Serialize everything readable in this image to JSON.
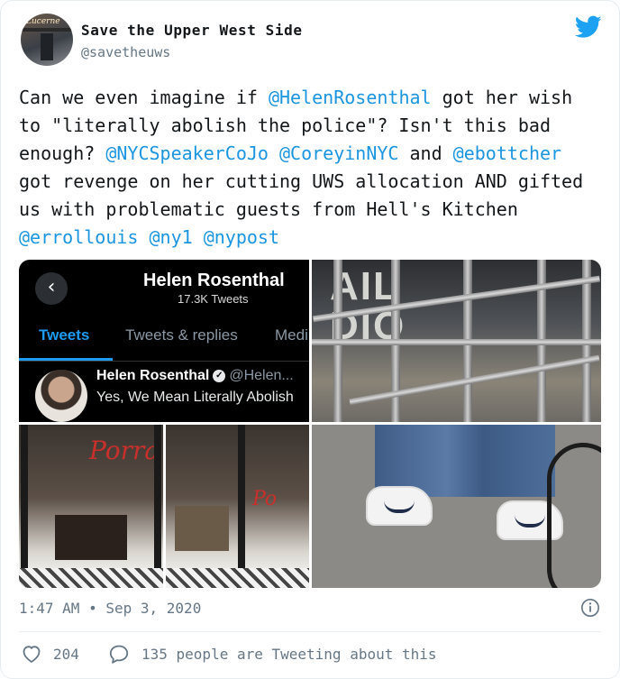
{
  "author": {
    "display_name": "Save the Upper West Side",
    "handle": "@savetheuws",
    "avatar_sign": "Lucerne"
  },
  "tweet": {
    "segments": [
      {
        "text": "Can we even imagine if ",
        "mention": false
      },
      {
        "text": "@HelenRosenthal",
        "mention": true
      },
      {
        "text": " got her wish to \"literally abolish the police\"? Isn't this bad enough? ",
        "mention": false
      },
      {
        "text": "@NYCSpeakerCoJo",
        "mention": true
      },
      {
        "text": " ",
        "mention": false
      },
      {
        "text": "@CoreyinNYC",
        "mention": true
      },
      {
        "text": " and ",
        "mention": false
      },
      {
        "text": "@ebottcher",
        "mention": true
      },
      {
        "text": " got revenge on her cutting UWS allocation AND gifted us with problematic guests from Hell's Kitchen ",
        "mention": false
      },
      {
        "text": "@errollouis",
        "mention": true
      },
      {
        "text": " ",
        "mention": false
      },
      {
        "text": "@ny1",
        "mention": true
      },
      {
        "text": " ",
        "mention": false
      },
      {
        "text": "@nypost",
        "mention": true
      }
    ]
  },
  "media": {
    "profile_screenshot": {
      "name": "Helen Rosenthal",
      "tweet_count": "17.3K Tweets",
      "tabs": [
        "Tweets",
        "Tweets & replies",
        "Medi"
      ],
      "mini_name": "Helen Rosenthal",
      "mini_handle": "@Helen...",
      "mini_text": "Yes, We Mean Literally Abolish"
    },
    "scaffold_sign": "AIL\nDIO",
    "store_script_1": "Porra",
    "store_script_2": "Po"
  },
  "footer": {
    "time": "1:47 AM",
    "separator": "•",
    "date": "Sep 3, 2020",
    "likes": "204",
    "replies_text": "135 people are Tweeting about this"
  },
  "colors": {
    "mention": "#1b95e0",
    "twitter_blue": "#1da1f2",
    "muted": "#657786"
  }
}
